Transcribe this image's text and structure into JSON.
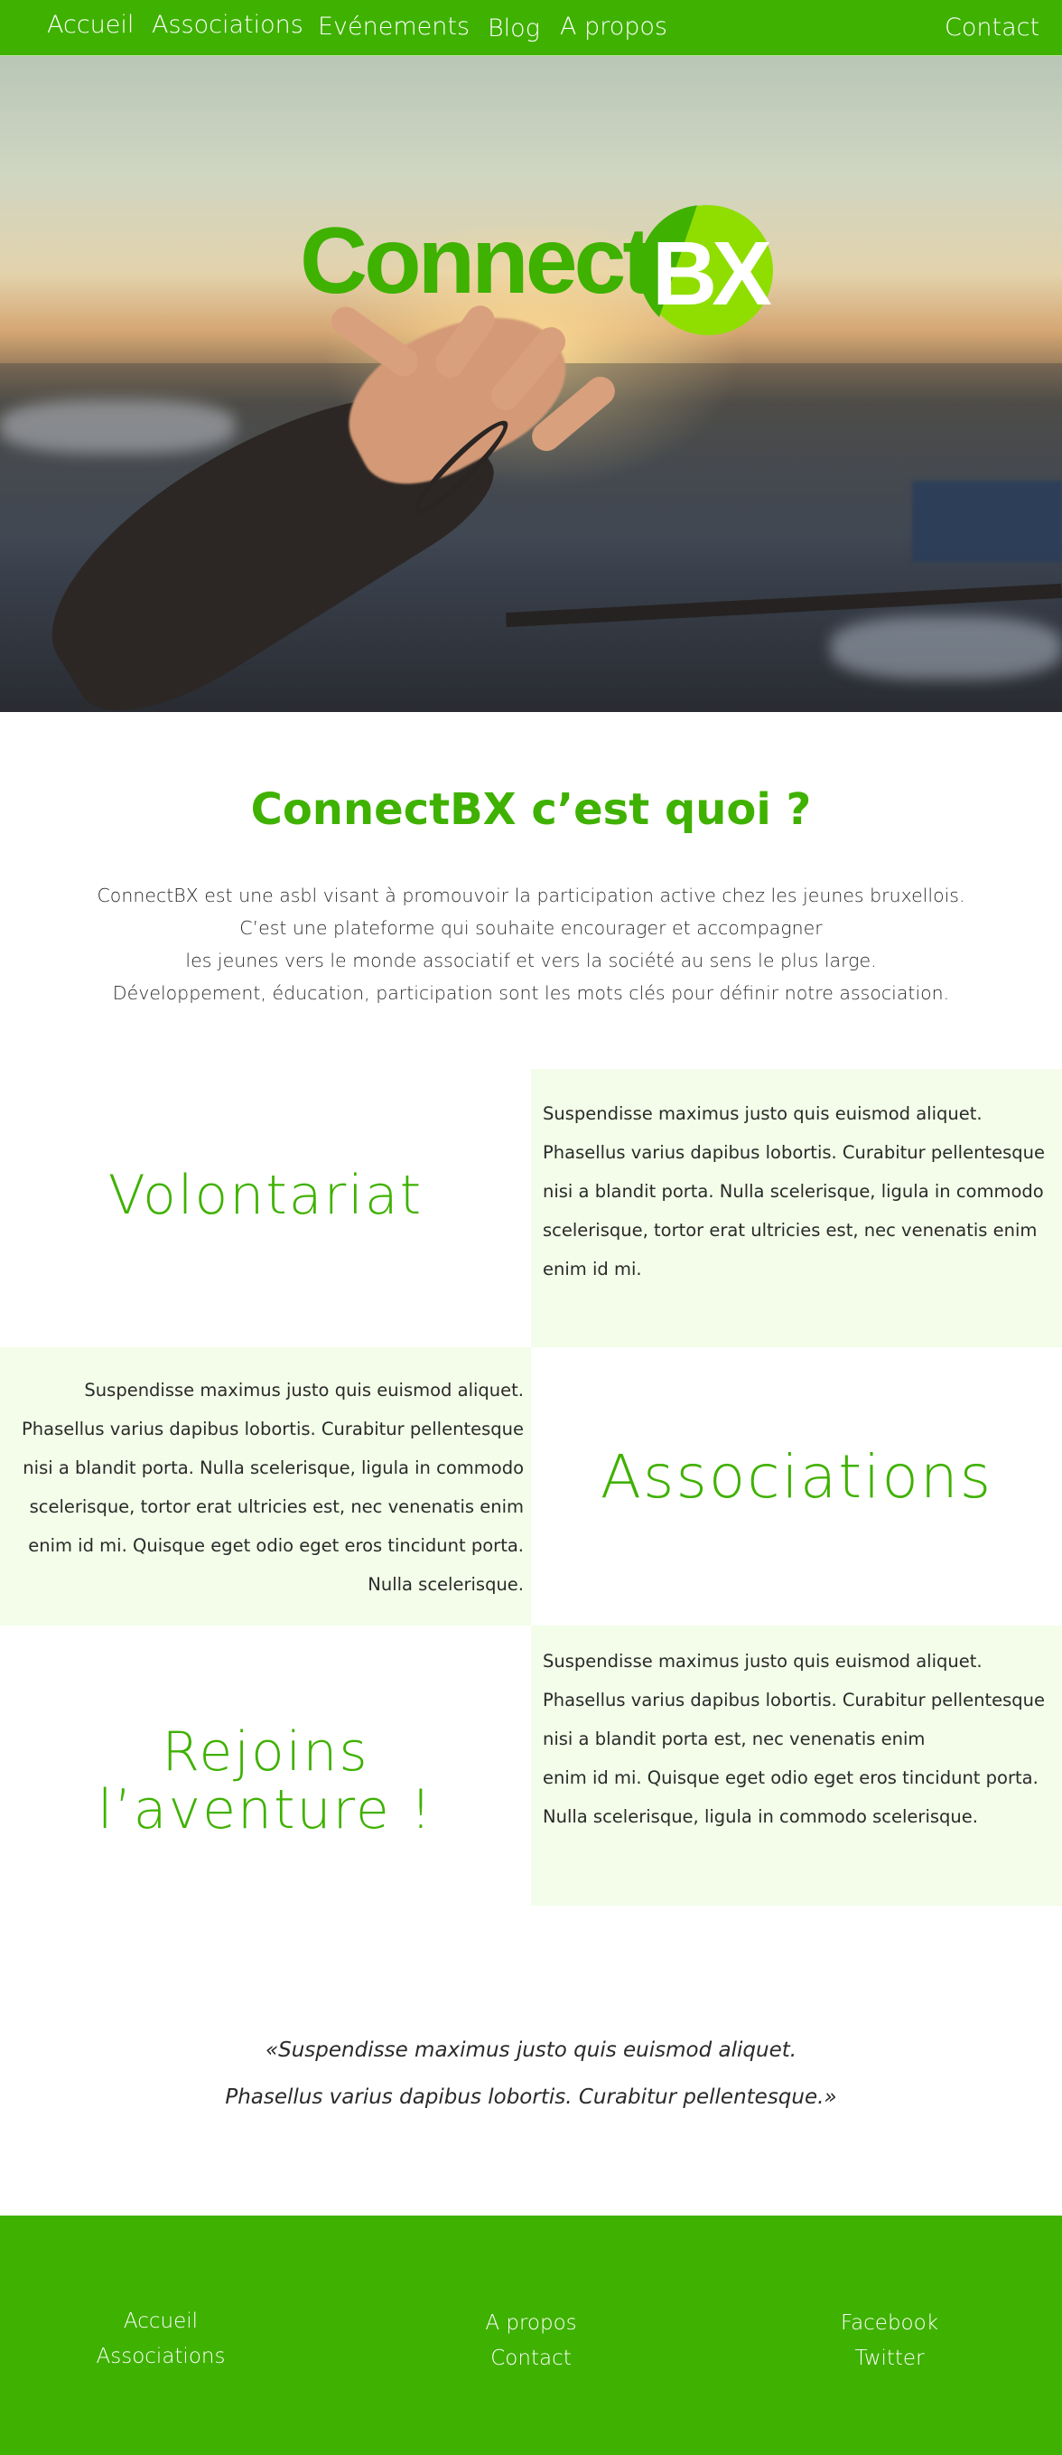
{
  "nav": {
    "items": [
      "Accueil",
      "Associations",
      "Evénements",
      "Blog",
      "A propos"
    ],
    "contact": "Contact"
  },
  "hero": {
    "logo_text": "Connect",
    "logo_badge": "BX"
  },
  "intro": {
    "title": "ConnectBX c’est quoi ?",
    "lines": [
      "ConnectBX est une asbl visant à promouvoir la participation active chez les jeunes bruxellois.",
      "C’est une plateforme qui souhaite encourager et accompagner",
      "les jeunes vers le monde associatif et vers la société au sens le plus large.",
      "Développement, éducation, participation sont les mots clés pour définir notre association."
    ]
  },
  "blocks": [
    {
      "heading": [
        "Volontariat"
      ],
      "lines": [
        "Suspendisse maximus justo quis euismod aliquet.",
        "Phasellus varius dapibus lobortis. Curabitur pellentesque",
        "nisi a blandit porta. Nulla scelerisque, ligula in commodo",
        "scelerisque, tortor erat ultricies est, nec venenatis enim",
        "enim id mi."
      ]
    },
    {
      "heading": [
        "Associations"
      ],
      "lines": [
        "Suspendisse maximus justo quis euismod aliquet.",
        "Phasellus varius dapibus lobortis. Curabitur pellentesque",
        "nisi a blandit porta. Nulla scelerisque, ligula in commodo",
        "scelerisque, tortor erat ultricies est, nec venenatis enim",
        "enim id mi. Quisque eget odio eget eros tincidunt porta.",
        "Nulla scelerisque."
      ]
    },
    {
      "heading": [
        "Rejoins",
        "l’aventure !"
      ],
      "lines": [
        "Suspendisse maximus justo quis euismod aliquet.",
        "Phasellus varius dapibus lobortis. Curabitur pellentesque",
        "nisi a blandit porta est, nec venenatis enim",
        "enim id mi. Quisque eget odio eget eros tincidunt porta.",
        "Nulla scelerisque, ligula in commodo scelerisque."
      ]
    }
  ],
  "quote": {
    "lines": [
      "«Suspendisse maximus justo quis euismod aliquet.",
      "Phasellus varius dapibus lobortis. Curabitur pellentesque.»"
    ]
  },
  "footer": {
    "col1": [
      "Accueil",
      "Associations"
    ],
    "col2": [
      "A propos",
      "Contact"
    ],
    "col3": [
      "Facebook",
      "Twitter"
    ]
  },
  "colors": {
    "brand_green": "#3fb100",
    "badge_green": "#8fde00",
    "pale_green": "#f3fde9"
  }
}
